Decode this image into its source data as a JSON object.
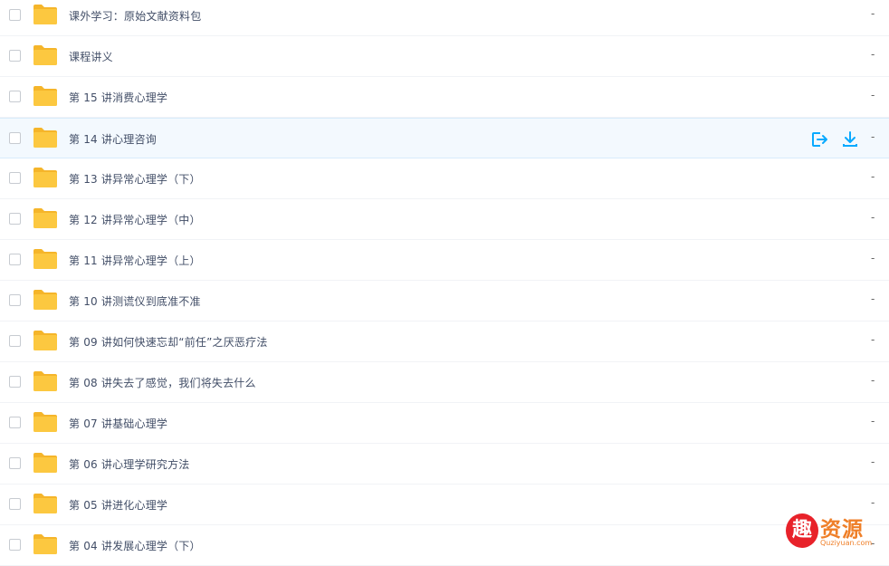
{
  "files": [
    {
      "name": "课外学习：原始文献资料包",
      "size": "-"
    },
    {
      "name": "课程讲义",
      "size": "-"
    },
    {
      "name": "第 15 讲消费心理学",
      "size": "-"
    },
    {
      "name": "第 14 讲心理咨询",
      "size": "-",
      "hover": true
    },
    {
      "name": "第 13 讲异常心理学（下）",
      "size": "-"
    },
    {
      "name": "第 12 讲异常心理学（中）",
      "size": "-"
    },
    {
      "name": "第 11 讲异常心理学（上）",
      "size": "-"
    },
    {
      "name": "第 10 讲测谎仪到底准不准",
      "size": "-"
    },
    {
      "name": "第 09 讲如何快速忘却“前任”之厌恶疗法",
      "size": "-"
    },
    {
      "name": "第 08 讲失去了感觉，我们将失去什么",
      "size": "-"
    },
    {
      "name": "第 07 讲基础心理学",
      "size": "-"
    },
    {
      "name": "第 06 讲心理学研究方法",
      "size": "-"
    },
    {
      "name": "第 05 讲进化心理学",
      "size": "-"
    },
    {
      "name": "第 04 讲发展心理学（下）",
      "size": "-"
    }
  ],
  "row_actions": {
    "share_icon": "share-export-icon",
    "download_icon": "download-icon"
  },
  "watermark": {
    "logo": "趣",
    "title": "资源",
    "subtitle": "Quziyuan.com"
  },
  "colors": {
    "folder": "#fcc840",
    "folder_tab": "#f5b52a",
    "accent": "#09aaff",
    "hover_bg": "#f3f9fe"
  }
}
